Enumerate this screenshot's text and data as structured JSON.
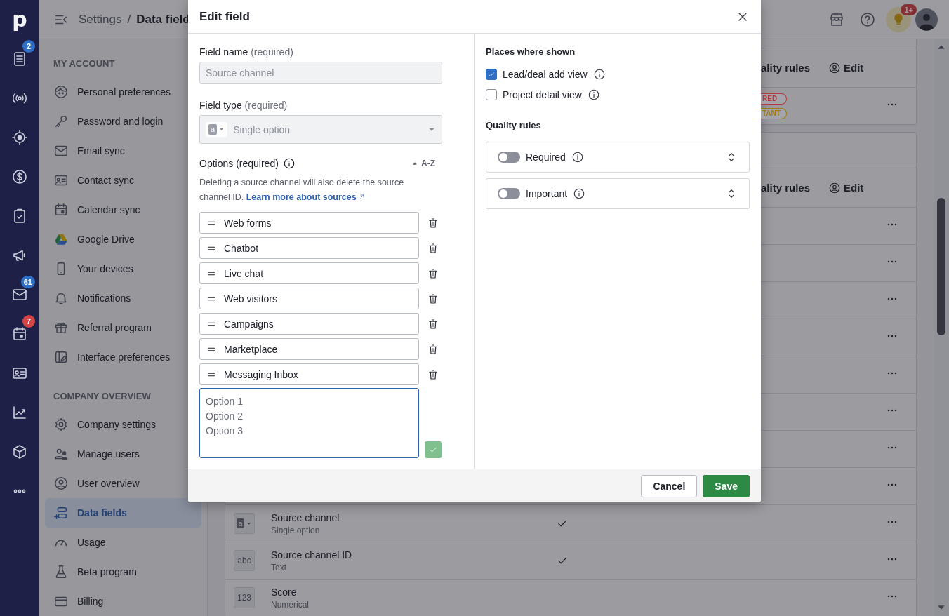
{
  "rail": {
    "logo": "p",
    "items": [
      {
        "kind": "icon",
        "badge": "2",
        "color": "#2f6fc6"
      },
      {
        "kind": "icon"
      },
      {
        "kind": "icon"
      },
      {
        "kind": "icon"
      },
      {
        "kind": "icon"
      },
      {
        "kind": "icon"
      },
      {
        "kind": "icon",
        "badge": "61",
        "color": "#2f6fc6"
      },
      {
        "kind": "icon",
        "badge": "7",
        "color": "#d64545"
      },
      {
        "kind": "icon"
      },
      {
        "kind": "icon"
      },
      {
        "kind": "icon"
      },
      {
        "kind": "more"
      }
    ]
  },
  "top_bar": {
    "breadcrumb": [
      {
        "label": "Settings",
        "current": false
      },
      {
        "label": "Data field",
        "current": true
      }
    ],
    "separator": "/",
    "tips_badge": "1+"
  },
  "sidebar": {
    "sections": [
      {
        "title": "MY ACCOUNT",
        "items": [
          {
            "label": "Personal preferences",
            "selected": false
          },
          {
            "label": "Password and login",
            "selected": false
          },
          {
            "label": "Email sync",
            "selected": false
          },
          {
            "label": "Contact sync",
            "selected": false
          },
          {
            "label": "Calendar sync",
            "selected": false
          },
          {
            "label": "Google Drive",
            "selected": false
          },
          {
            "label": "Your devices",
            "selected": false
          },
          {
            "label": "Notifications",
            "selected": false
          },
          {
            "label": "Referral program",
            "selected": false
          },
          {
            "label": "Interface preferences",
            "selected": false
          }
        ]
      },
      {
        "title": "COMPANY OVERVIEW",
        "items": [
          {
            "label": "Company settings",
            "selected": false
          },
          {
            "label": "Manage users",
            "selected": false
          },
          {
            "label": "User overview",
            "selected": false
          },
          {
            "label": "Data fields",
            "selected": true
          },
          {
            "label": "Usage",
            "selected": false
          },
          {
            "label": "Beta program",
            "selected": false
          },
          {
            "label": "Billing",
            "selected": false
          }
        ]
      }
    ]
  },
  "fields_list": {
    "cards": [
      {
        "header": {
          "column": "ality rules",
          "edit": "Edit"
        },
        "rows": [
          {
            "kind": "covered",
            "tags": [
              {
                "label": "RED",
                "color": "#b23a3a"
              },
              {
                "label": "TANT",
                "color": "#9e7a12"
              }
            ]
          }
        ]
      },
      {
        "header": {
          "column": "ality rules",
          "edit": "Edit"
        },
        "rows": [
          {
            "kind": "covered"
          },
          {
            "kind": "covered"
          },
          {
            "kind": "covered"
          },
          {
            "kind": "covered"
          },
          {
            "kind": "covered"
          },
          {
            "kind": "covered"
          },
          {
            "kind": "covered"
          },
          {
            "kind": "covered"
          },
          {
            "kind": "field",
            "type_badge": "a",
            "badge_caret": true,
            "name": "Source channel",
            "type": "Single option",
            "checked": true
          },
          {
            "kind": "field",
            "type_badge": "abc",
            "name": "Source channel ID",
            "type": "Text",
            "checked": true
          },
          {
            "kind": "field",
            "type_badge": "123",
            "name": "Score",
            "type": "Numerical",
            "checked": false
          }
        ]
      }
    ]
  },
  "dialog": {
    "title": "Edit field",
    "field_name": {
      "label": "Field name",
      "hint": "(required)",
      "value": "Source channel",
      "disabled": true
    },
    "field_type": {
      "label": "Field type",
      "hint": "(required)",
      "type_badge": "a",
      "value": "Single option",
      "disabled": true
    },
    "options": {
      "label": "Options (required)",
      "sort": "A-Z",
      "help": "Deleting a source channel will also delete the source channel ID.",
      "link": "Learn more about sources",
      "items": [
        "Web forms",
        "Chatbot",
        "Live chat",
        "Web visitors",
        "Campaigns",
        "Marketplace",
        "Messaging Inbox"
      ],
      "new_placeholder": "Option 1\nOption 2\nOption 3"
    },
    "places": {
      "title": "Places where shown",
      "items": [
        {
          "label": "Lead/deal add view",
          "checked": true
        },
        {
          "label": "Project detail view",
          "checked": false
        }
      ]
    },
    "quality": {
      "title": "Quality rules",
      "items": [
        {
          "label": "Required",
          "on": false
        },
        {
          "label": "Important",
          "on": false
        }
      ]
    },
    "buttons": {
      "cancel": "Cancel",
      "save": "Save"
    }
  }
}
